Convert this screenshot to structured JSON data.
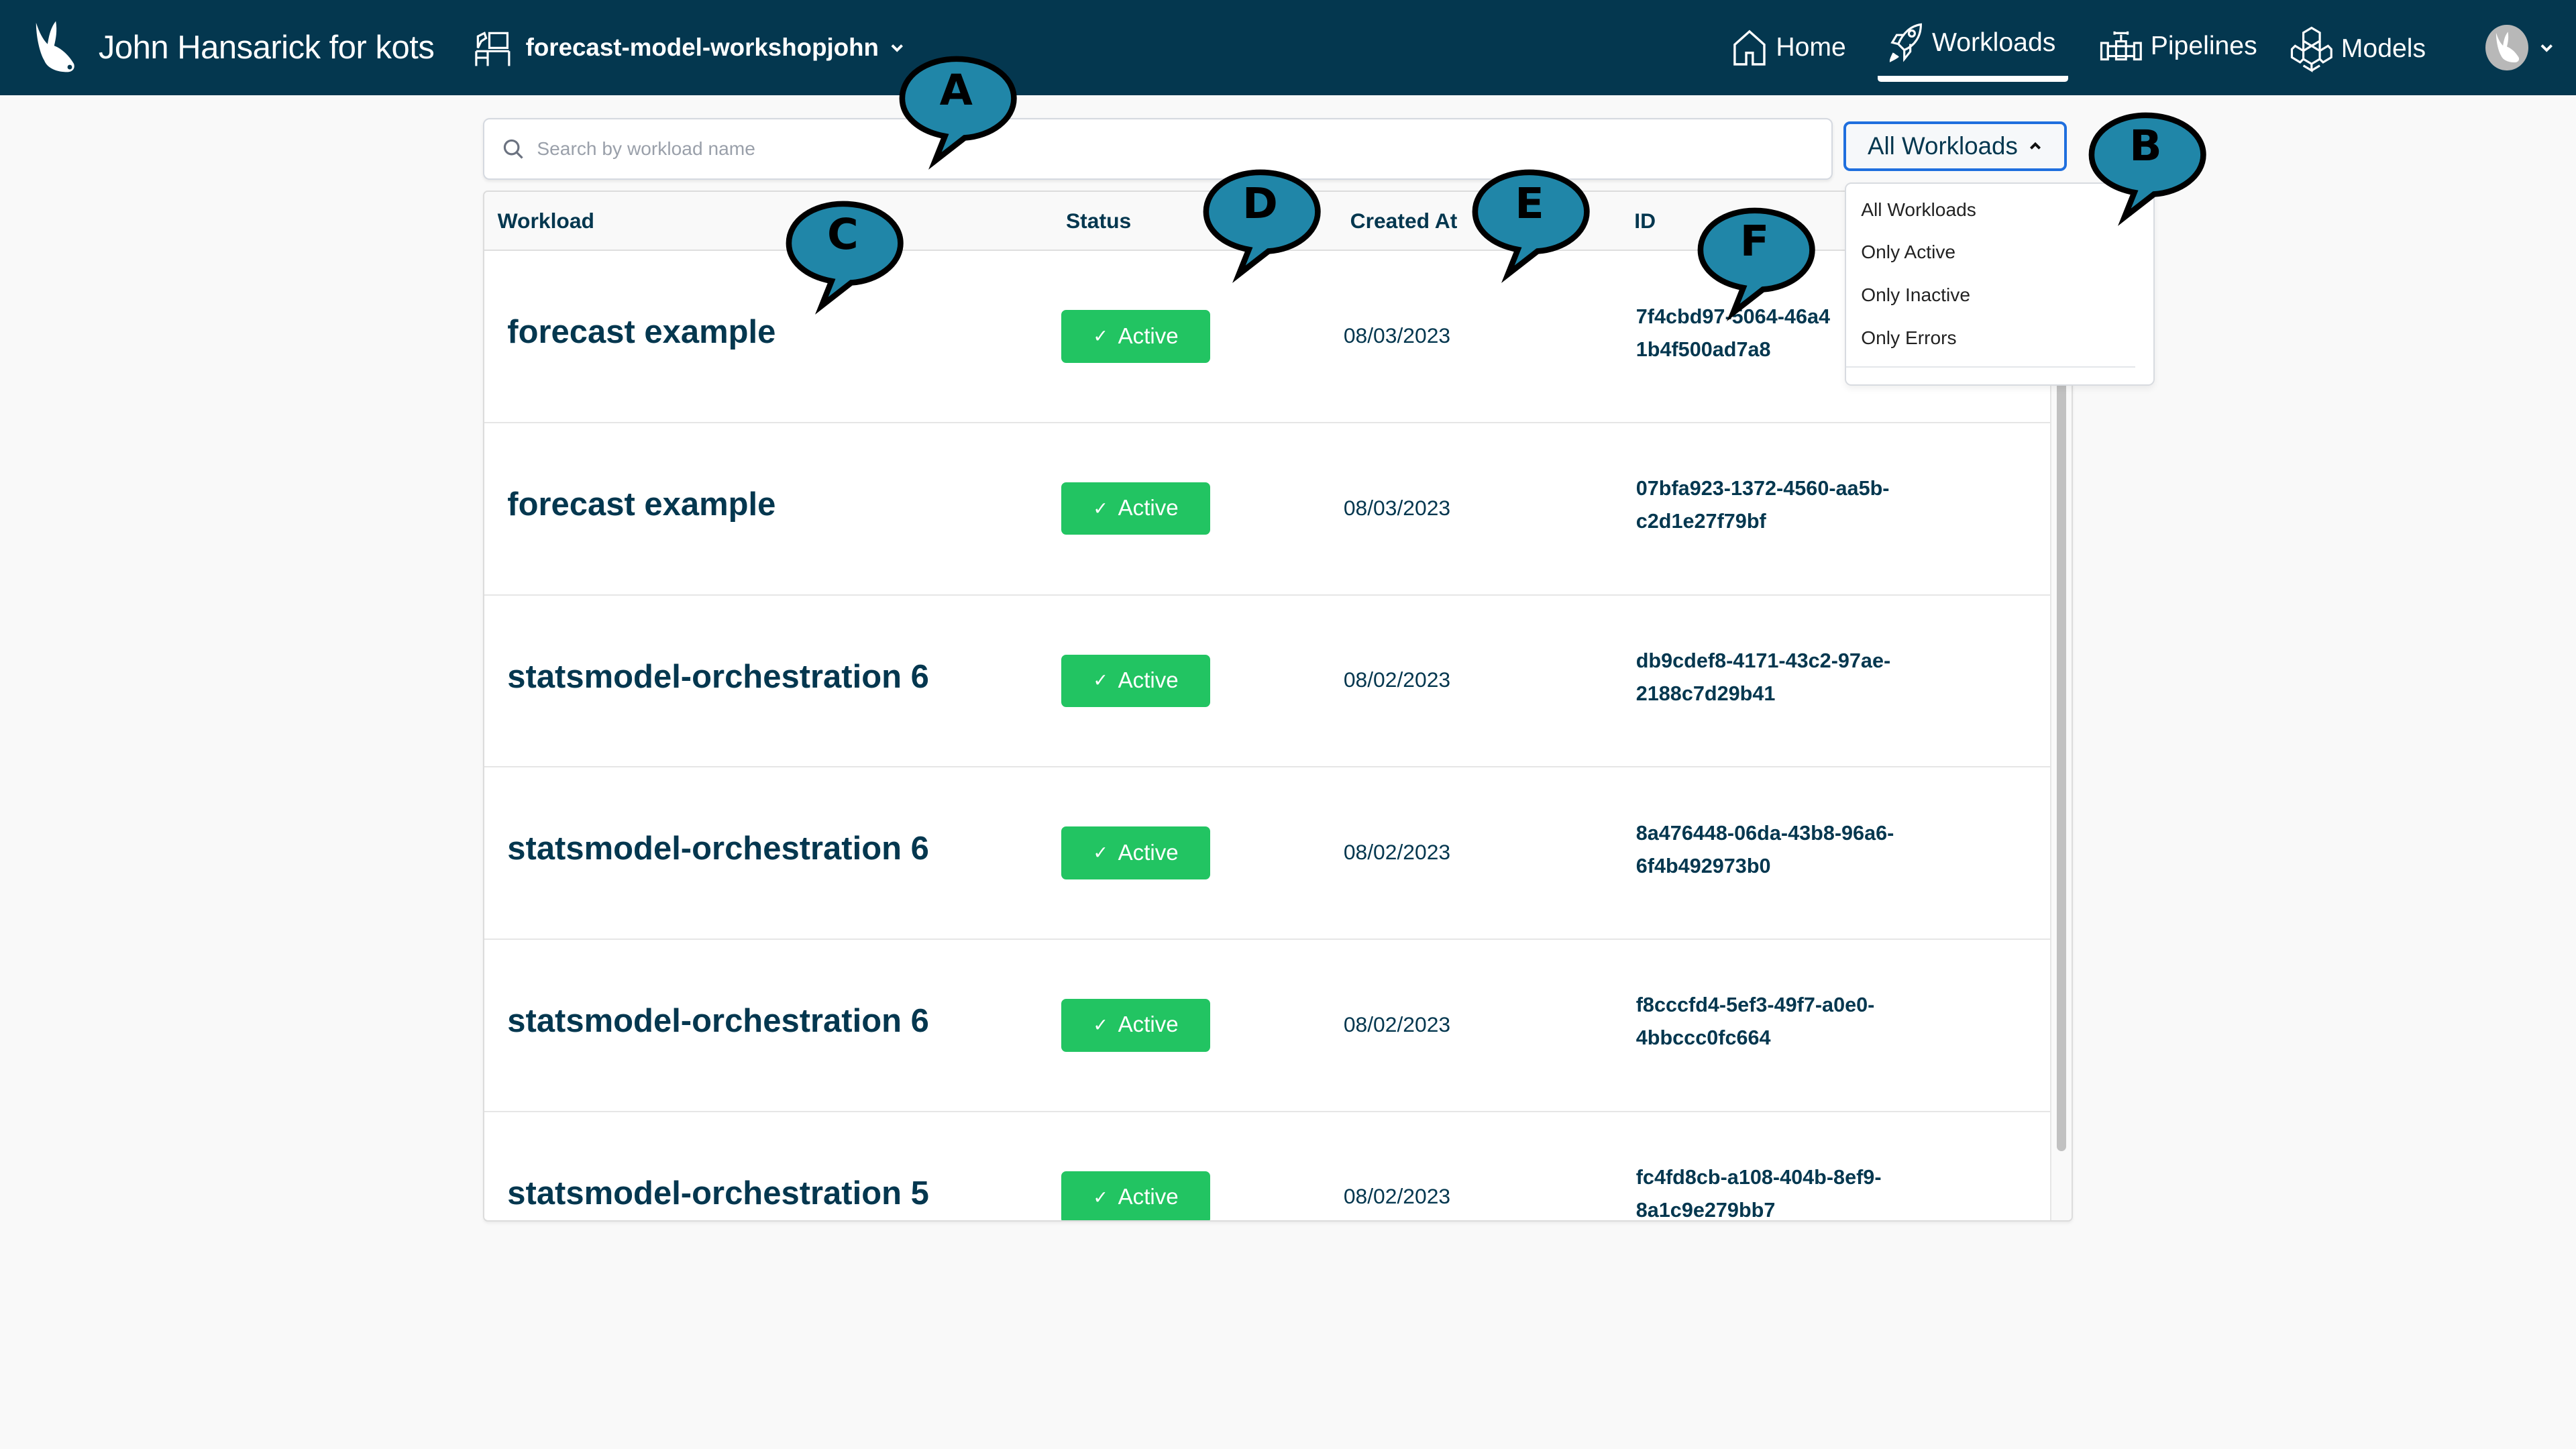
{
  "topbar": {
    "org_name": "John Hansarick for kots",
    "workspace_name": "forecast-model-workshopjohn",
    "nav": [
      {
        "label": "Home",
        "icon": "home-icon"
      },
      {
        "label": "Workloads",
        "icon": "rocket-icon",
        "active": true
      },
      {
        "label": "Pipelines",
        "icon": "pipeline-valve-icon"
      },
      {
        "label": "Models",
        "icon": "cubes-icon"
      }
    ],
    "colors": {
      "background": "#04374f",
      "text": "#ffffff"
    }
  },
  "search": {
    "placeholder": "Search by workload name",
    "value": ""
  },
  "filter": {
    "selected": "All Workloads",
    "expanded": true,
    "options": [
      "All Workloads",
      "Only Active",
      "Only Inactive",
      "Only Errors"
    ]
  },
  "table": {
    "columns": [
      "Workload",
      "Status",
      "Created At",
      "ID"
    ],
    "rows": [
      {
        "name": "forecast example",
        "status": "Active",
        "created_at": "08/03/2023",
        "id": "7f4cbd97-5064-46a4-…-1b4f500ad7a8",
        "id_line1": "7f4cbd97-5064-46a4",
        "id_line2": "1b4f500ad7a8"
      },
      {
        "name": "forecast example",
        "status": "Active",
        "created_at": "08/03/2023",
        "id": "07bfa923-1372-4560-aa5b-c2d1e27f79bf",
        "id_line1": "07bfa923-1372-4560-aa5b-",
        "id_line2": "c2d1e27f79bf"
      },
      {
        "name": "statsmodel-orchestration 6",
        "status": "Active",
        "created_at": "08/02/2023",
        "id": "db9cdef8-4171-43c2-97ae-2188c7d29b41",
        "id_line1": "db9cdef8-4171-43c2-97ae-",
        "id_line2": "2188c7d29b41"
      },
      {
        "name": "statsmodel-orchestration 6",
        "status": "Active",
        "created_at": "08/02/2023",
        "id": "8a476448-06da-43b8-96a6-6f4b492973b0",
        "id_line1": "8a476448-06da-43b8-96a6-",
        "id_line2": "6f4b492973b0"
      },
      {
        "name": "statsmodel-orchestration 6",
        "status": "Active",
        "created_at": "08/02/2023",
        "id": "f8cccfd4-5ef3-49f7-a0e0-4bbccc0fc664",
        "id_line1": "f8cccfd4-5ef3-49f7-a0e0-",
        "id_line2": "4bbccc0fc664"
      },
      {
        "name": "statsmodel-orchestration 5",
        "status": "Active",
        "created_at": "08/02/2023",
        "id": "fc4fd8cb-a108-404b-8ef9-8a1c9e279bb7",
        "id_line1": "fc4fd8cb-a108-404b-8ef9-",
        "id_line2": "8a1c9e279bb7"
      }
    ],
    "status_color": "#22c462",
    "check_glyph": "✓"
  },
  "callouts": [
    {
      "letter": "A",
      "target": "search input"
    },
    {
      "letter": "B",
      "target": "workload filter dropdown"
    },
    {
      "letter": "C",
      "target": "workload name column"
    },
    {
      "letter": "D",
      "target": "status column"
    },
    {
      "letter": "E",
      "target": "created at column"
    },
    {
      "letter": "F",
      "target": "id column"
    }
  ],
  "callout_color": "#2086a8"
}
